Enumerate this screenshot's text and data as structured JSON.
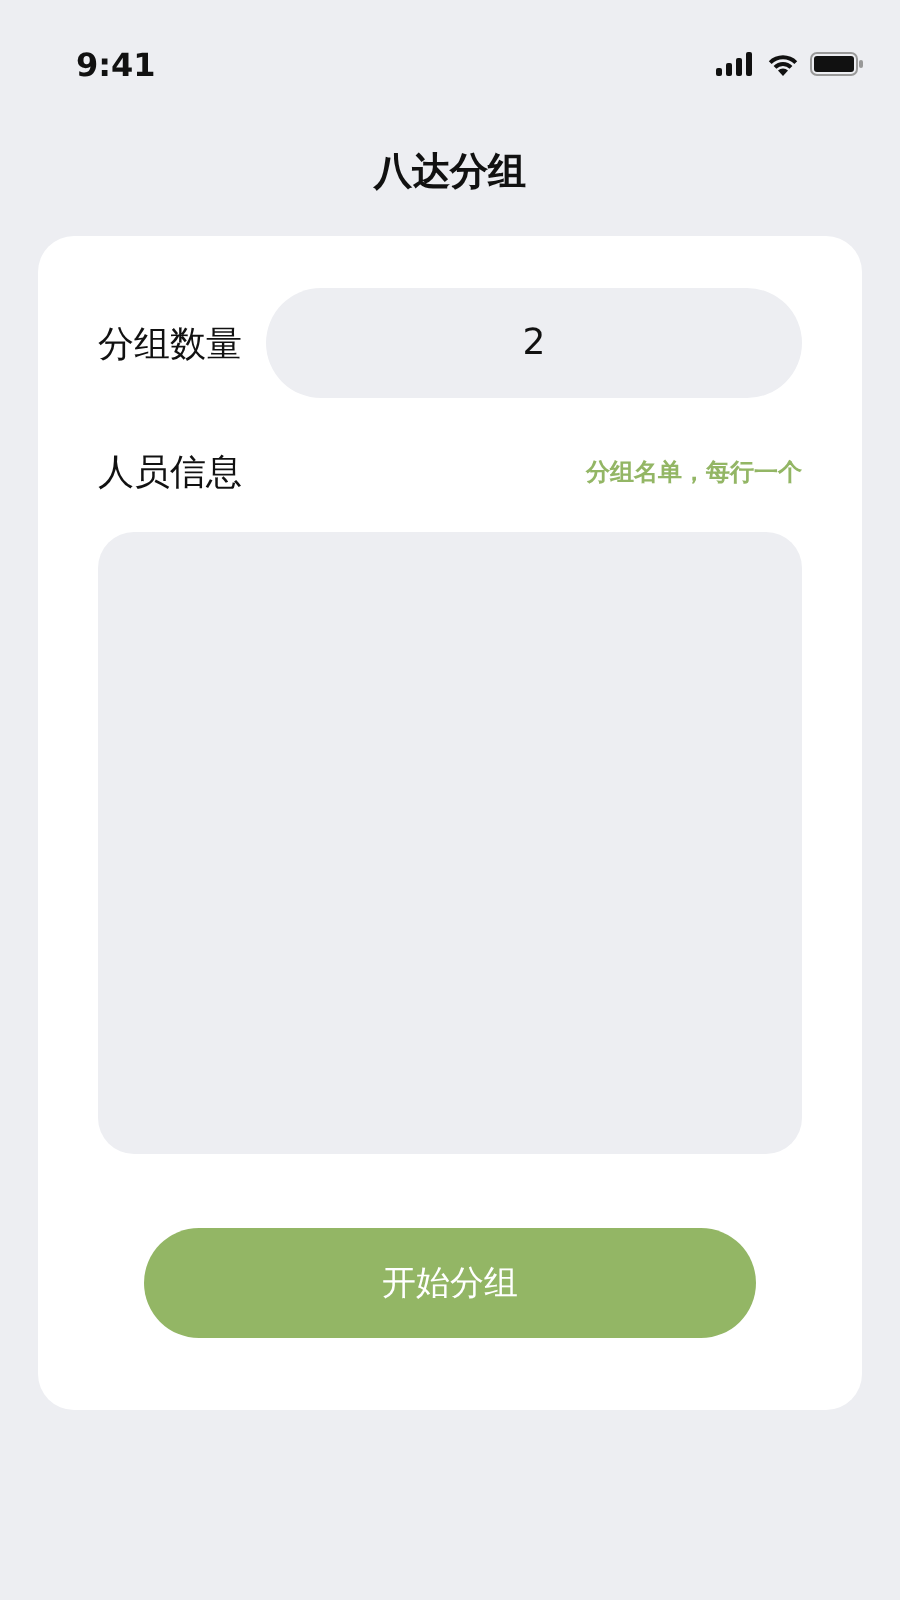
{
  "status_bar": {
    "time": "9:41"
  },
  "title": "八达分组",
  "group_count": {
    "label": "分组数量",
    "value": "2"
  },
  "members": {
    "label": "人员信息",
    "hint": "分组名单，每行一个"
  },
  "button": "开始分组"
}
